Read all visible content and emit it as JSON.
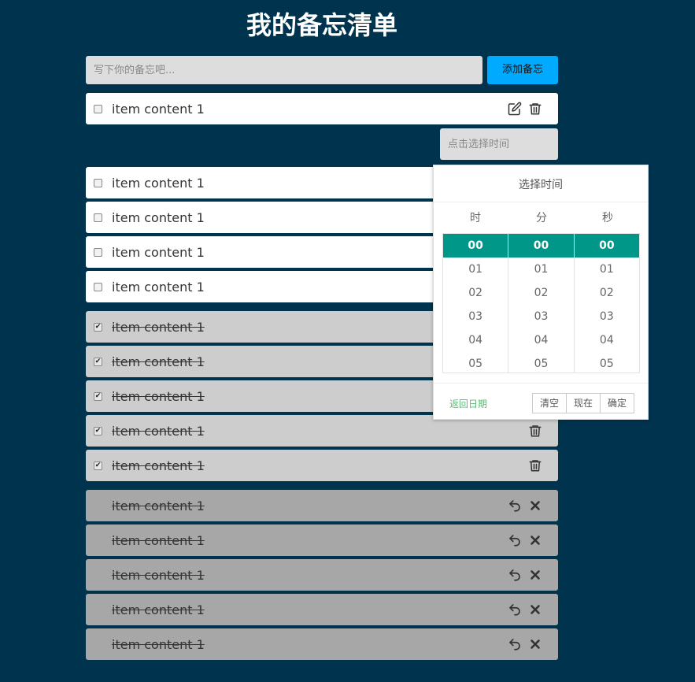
{
  "title": "我的备忘清单",
  "input": {
    "placeholder": "写下你的备忘吧...",
    "add_label": "添加备忘"
  },
  "todo_items": [
    {
      "text": "item content 1"
    },
    {
      "text": "item content 1"
    },
    {
      "text": "item content 1"
    },
    {
      "text": "item content 1"
    },
    {
      "text": "item content 1"
    }
  ],
  "done_items": [
    {
      "text": "item content 1"
    },
    {
      "text": "item content 1"
    },
    {
      "text": "item content 1"
    },
    {
      "text": "item content 1"
    },
    {
      "text": "item content 1"
    }
  ],
  "deleted_items": [
    {
      "text": "item content 1"
    },
    {
      "text": "item content 1"
    },
    {
      "text": "item content 1"
    },
    {
      "text": "item content 1"
    },
    {
      "text": "item content 1"
    }
  ],
  "time_input": {
    "placeholder": "点击选择时间"
  },
  "time_picker": {
    "title": "选择时间",
    "columns": [
      "时",
      "分",
      "秒"
    ],
    "values": [
      "00",
      "01",
      "02",
      "03",
      "04",
      "05"
    ],
    "selected": "00",
    "selected_color": "#009688",
    "back_label": "返回日期",
    "clear_label": "清空",
    "now_label": "现在",
    "confirm_label": "确定"
  },
  "icons": {
    "edit": "edit-icon",
    "delete": "trash-icon",
    "restore": "undo-icon",
    "remove": "close-icon"
  },
  "colors": {
    "background": "#00334e",
    "accent": "#00aaff",
    "todo_bg": "#ffffff",
    "done_bg": "#cdcdcd",
    "deleted_bg": "#a7a7a7"
  }
}
